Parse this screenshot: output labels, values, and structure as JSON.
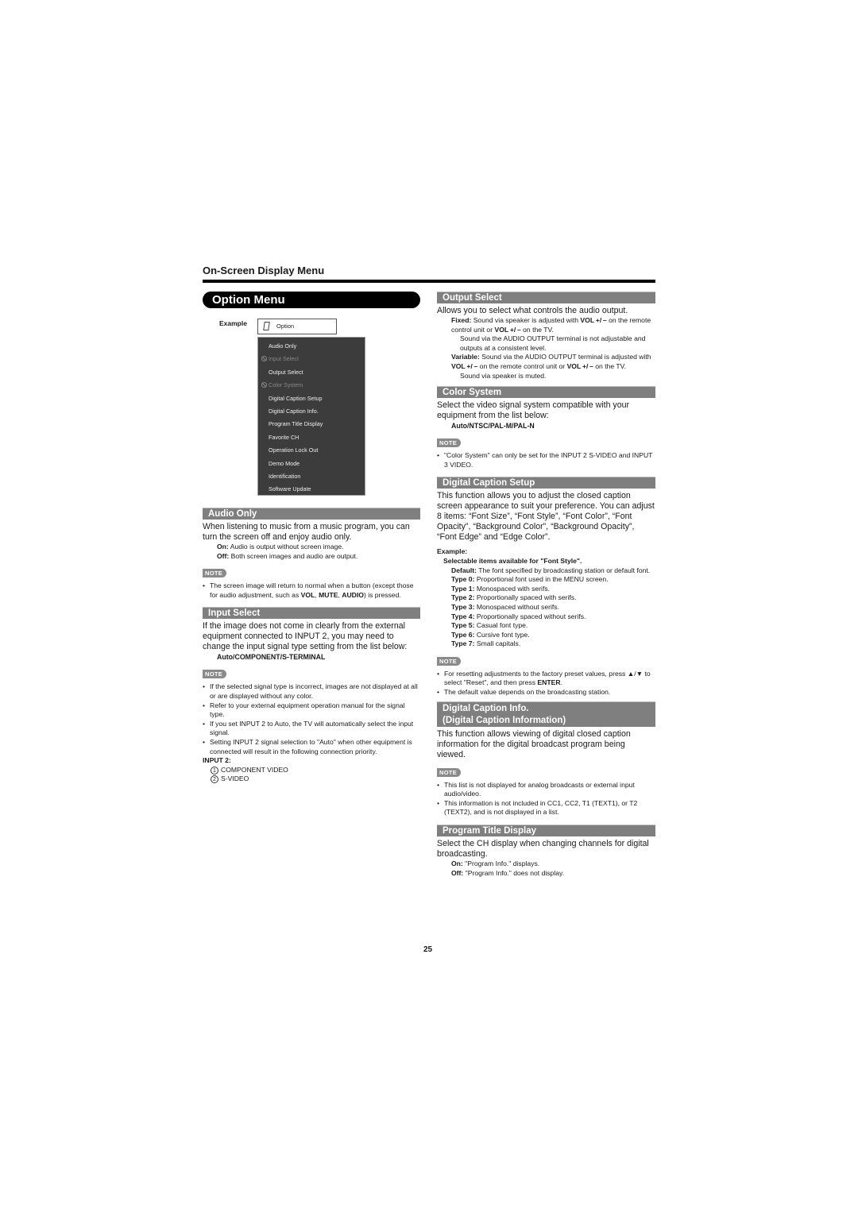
{
  "header": {
    "section": "On-Screen Display Menu",
    "title": "Option Menu"
  },
  "example": {
    "label": "Example",
    "option_label": "Option",
    "menu_items": [
      {
        "label": "Audio Only",
        "disabled": false
      },
      {
        "label": "Input Select",
        "disabled": true
      },
      {
        "label": "Output Select",
        "disabled": false
      },
      {
        "label": "Color System",
        "disabled": true
      },
      {
        "label": "Digital Caption Setup",
        "disabled": false
      },
      {
        "label": "Digital Caption Info.",
        "disabled": false
      },
      {
        "label": "Program Title Display",
        "disabled": false
      },
      {
        "label": "Favorite CH",
        "disabled": false
      },
      {
        "label": "Operation Lock Out",
        "disabled": false
      },
      {
        "label": "Demo Mode",
        "disabled": false
      },
      {
        "label": "Identification",
        "disabled": false
      },
      {
        "label": "Software Update",
        "disabled": false
      }
    ]
  },
  "note_label": "NOTE",
  "audio_only": {
    "title": "Audio Only",
    "body": "When listening to music from a music program, you can turn the screen off and enjoy audio only.",
    "on_label": "On:",
    "on_text": " Audio is output without screen image.",
    "off_label": "Off:",
    "off_text": " Both screen images and audio are output.",
    "note_1a": "The screen image will return to normal when a button (except those for audio adjustment, such as ",
    "note_1b": "VOL",
    "note_1c": ", ",
    "note_1d": "MUTE",
    "note_1e": ", ",
    "note_1f": "AUDIO",
    "note_1g": ") is pressed."
  },
  "input_select": {
    "title": "Input Select",
    "body": "If the image does not come in clearly from the external equipment connected to INPUT 2, you may need to change the input signal type setting from the list below:",
    "options": "Auto/COMPONENT/S-TERMINAL",
    "notes": [
      "If the selected signal type is incorrect, images are not displayed at all or are displayed without any color.",
      "Refer to your external equipment operation manual for the signal type.",
      "If you set INPUT 2 to Auto, the TV will automatically select the input signal.",
      "Setting INPUT 2 signal selection to \"Auto\" when other equipment is connected will result in the following connection priority."
    ],
    "priority_label": "INPUT 2:",
    "priority": [
      {
        "num": "1",
        "label": "COMPONENT VIDEO"
      },
      {
        "num": "2",
        "label": "S-VIDEO"
      }
    ]
  },
  "output_select": {
    "title": "Output Select",
    "body": "Allows you to select what controls the audio output.",
    "fixed_label": "Fixed:",
    "fixed_a": " Sound via speaker is adjusted with ",
    "vol": "VOL +/ –",
    "fixed_b": " on the remote control unit or ",
    "fixed_c": " on the TV.",
    "fixed_d": "Sound via the AUDIO OUTPUT terminal is not adjustable and outputs at a consistent level.",
    "variable_label": "Variable:",
    "variable_a": " Sound via the AUDIO OUTPUT terminal is adjusted with ",
    "variable_b": " on the remote control unit or ",
    "variable_c": " on the TV.",
    "variable_d": "Sound via speaker is muted."
  },
  "color_system": {
    "title": "Color System",
    "body": "Select the video signal system compatible with your equipment from the list below:",
    "options": "Auto/NTSC/PAL-M/PAL-N",
    "note": "\"Color System\" can only be set for the INPUT 2 S-VIDEO and INPUT 3 VIDEO."
  },
  "digital_caption_setup": {
    "title": "Digital Caption Setup",
    "body": "This function allows you to adjust the closed caption screen appearance to suit your preference. You can adjust 8 items: “Font Size”, “Font Style”, “Font Color”, “Font Opacity”, “Background Color”, “Background Opacity”, “Font Edge” and “Edge Color”.",
    "example_label": "Example:",
    "example_sub": "Selectable items available for \"Font Style\".",
    "items": [
      {
        "label": "Default:",
        "text": " The font specified by broadcasting station or default font."
      },
      {
        "label": "Type 0:",
        "text": " Proportional font used in the MENU screen."
      },
      {
        "label": "Type 1:",
        "text": " Monospaced with serifs."
      },
      {
        "label": "Type 2:",
        "text": " Proportionally spaced with serifs."
      },
      {
        "label": "Type 3:",
        "text": " Monospaced without serifs."
      },
      {
        "label": "Type 4:",
        "text": " Proportionally spaced without serifs."
      },
      {
        "label": "Type 5:",
        "text": " Casual font type."
      },
      {
        "label": "Type 6:",
        "text": " Cursive font type."
      },
      {
        "label": "Type 7:",
        "text": " Small capitals."
      }
    ],
    "note_1a": "For resetting adjustments to the factory preset values, press ▲/▼ to select \"Reset\", and then press ",
    "note_1b": "ENTER",
    "note_1c": ".",
    "note_2": "The default value depends on the broadcasting station."
  },
  "digital_caption_info": {
    "title_1": "Digital Caption Info.",
    "title_2": "(Digital Caption Information)",
    "body": "This function allows viewing of digital closed caption information for the digital broadcast program being viewed.",
    "notes": [
      "This list is not displayed for analog broadcasts or external input audio/video.",
      "This information is not included in CC1, CC2, T1 (TEXT1), or T2 (TEXT2), and is not displayed in a list."
    ]
  },
  "program_title_display": {
    "title": "Program Title Display",
    "body": "Select the CH display when changing channels for digital broadcasting.",
    "on_label": "On:",
    "on_text": " \"Program Info.\" displays.",
    "off_label": "Off:",
    "off_text": " \"Program Info.\" does not display."
  },
  "page_number": "25"
}
